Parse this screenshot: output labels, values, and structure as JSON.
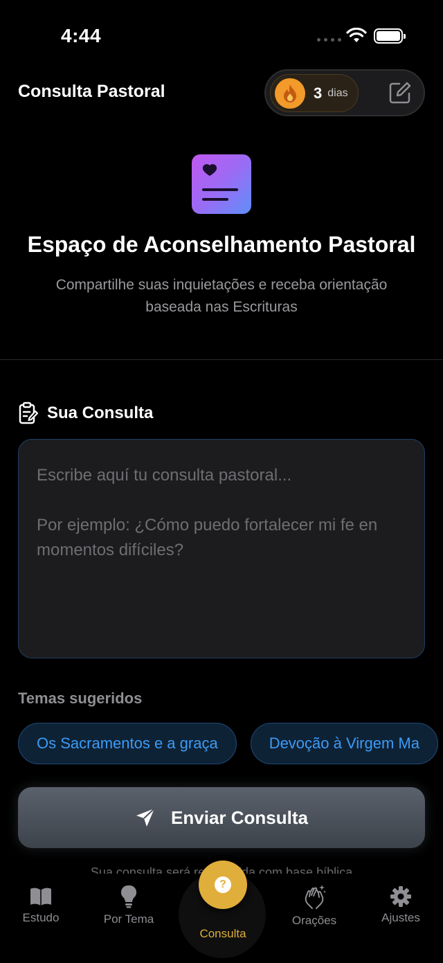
{
  "status": {
    "time": "4:44"
  },
  "header": {
    "title": "Consulta Pastoral",
    "streak_count": "3",
    "streak_unit": "dias"
  },
  "hero": {
    "title": "Espaço de Aconselhamento Pastoral",
    "subtitle": "Compartilhe suas inquietações e receba orientação baseada nas Escrituras"
  },
  "consulta": {
    "section_title": "Sua Consulta",
    "placeholder": "Escribe aquí tu consulta pastoral...\n\nPor ejemplo: ¿Cómo puedo fortalecer mi fe en momentos difíciles?"
  },
  "topics": {
    "label": "Temas sugeridos",
    "items": [
      "Os Sacramentos e a graça",
      "Devoção à Virgem Ma"
    ]
  },
  "send_button": {
    "label": "Enviar Consulta"
  },
  "footnote": "Sua consulta será respondida com base bíblica",
  "tabbar": {
    "items": [
      {
        "label": "Estudo",
        "icon": "book-icon"
      },
      {
        "label": "Por Tema",
        "icon": "lightbulb-icon"
      },
      {
        "label": "Consulta",
        "icon": "question-icon"
      },
      {
        "label": "Orações",
        "icon": "praying-hands-icon"
      },
      {
        "label": "Ajustes",
        "icon": "gear-icon"
      }
    ]
  },
  "colors": {
    "accent_blue": "#3d9bf5",
    "accent_gold": "#e0ae3a",
    "streak_orange": "#f29a2a"
  }
}
